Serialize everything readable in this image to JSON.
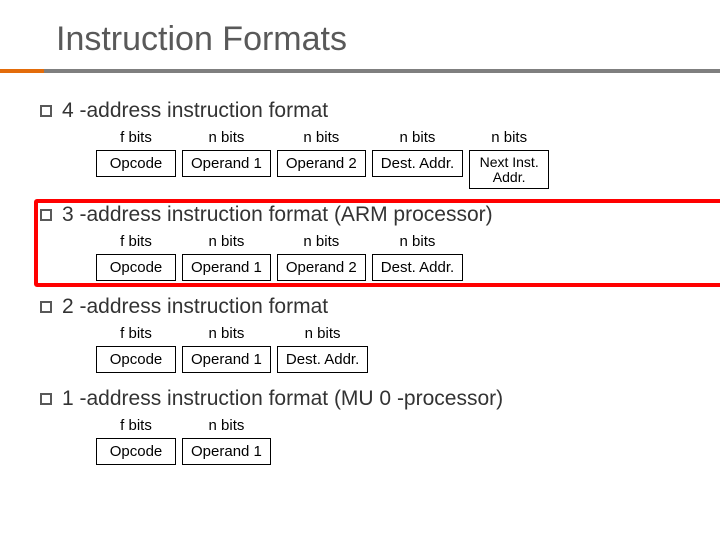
{
  "title": "Instruction Formats",
  "sections": [
    {
      "heading": "4 -address instruction format",
      "fields": [
        {
          "label": "f bits",
          "box": "Opcode"
        },
        {
          "label": "n bits",
          "box": "Operand 1"
        },
        {
          "label": "n bits",
          "box": "Operand 2"
        },
        {
          "label": "n bits",
          "box": "Dest. Addr."
        },
        {
          "label": "n bits",
          "box": "Next Inst. Addr."
        }
      ]
    },
    {
      "heading": "3 -address instruction format (ARM processor)",
      "fields": [
        {
          "label": "f bits",
          "box": "Opcode"
        },
        {
          "label": "n bits",
          "box": "Operand 1"
        },
        {
          "label": "n bits",
          "box": "Operand 2"
        },
        {
          "label": "n bits",
          "box": "Dest. Addr."
        }
      ]
    },
    {
      "heading": "2 -address instruction format",
      "fields": [
        {
          "label": "f bits",
          "box": "Opcode"
        },
        {
          "label": "n bits",
          "box": "Operand 1"
        },
        {
          "label": "n bits",
          "box": "Dest. Addr."
        }
      ]
    },
    {
      "heading": "1 -address instruction format (MU 0 -processor)",
      "fields": [
        {
          "label": "f bits",
          "box": "Opcode"
        },
        {
          "label": "n bits",
          "box": "Operand 1"
        }
      ]
    }
  ]
}
